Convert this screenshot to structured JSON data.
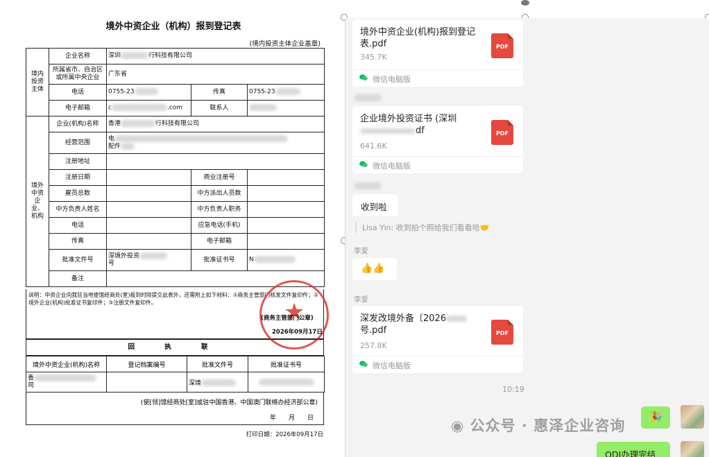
{
  "document": {
    "title": "境外中资企业（机构）报到登记表",
    "subtitle": "(境内投资主体企业盖章)",
    "section_domestic": "境内投资主体",
    "section_overseas": "境外中资企业、机构",
    "labels": {
      "company_name": "企业名称",
      "province": "所属省市、自治区或所属中央企业",
      "phone": "电话",
      "fax": "传真",
      "email": "电子邮箱",
      "contact": "联系人",
      "overseas_name": "企业(机构)名称",
      "scope": "经营范围",
      "reg_address": "注册地址",
      "reg_date": "注册日期",
      "biz_reg_no": "商业注册号",
      "employees": "雇员总数",
      "cn_staff": "中方派出人员数",
      "cn_head_name": "中方负责人姓名",
      "cn_head_title": "中方负责人职务",
      "phone2": "电话",
      "emergency_phone": "应急电话(手机)",
      "fax2": "传真",
      "email2": "电子邮箱",
      "approval_doc_no": "批准文件号",
      "approval_cert_no": "批准证书号",
      "remarks": "备注"
    },
    "values": {
      "company_name_pre": "深圳",
      "company_name_post": "行科技有限公司",
      "province": "广东省",
      "phone": "0755-23",
      "fax": "0755-23",
      "email_pre": "c",
      "email_post": ".com",
      "overseas_name_pre": "香港",
      "overseas_name_post": "行科技有限公司",
      "scope_line1": "电",
      "scope_line2": "配件",
      "approval_doc": "深境外投资",
      "approval_doc2": "号",
      "approval_cert": "N"
    },
    "note": "说明：中资企业向我驻当地使馆经商处(室)报到时除提交此表外，还需附上如下材料：①商务主管部门核发文件复印件；②境外企业(机构)批准证书复印件；③注册文件复印件。",
    "seal_text": "(商务主管部门公章)",
    "seal_date": "2026年09月17日",
    "receipt_title": "回 执 联",
    "receipt_headers": [
      "境外中资企业(机构)名称",
      "登记档案编号",
      "批准文件号",
      "批准证书号"
    ],
    "receipt_row_pre": "香",
    "receipt_row_pre2": "司",
    "receipt_doc": "深境",
    "receipt_sign": "(使[领]馆经商处[室]或驻中国香港、中国澳门联络办经济部公章)",
    "receipt_date": "年　　月　　日",
    "print_date": "打印日期：2026年09月17日"
  },
  "chat": {
    "messages": [
      {
        "type": "file",
        "name": "境外中资企业(机构)报到登记表.pdf",
        "size": "345.7K",
        "source": "微信电脑版",
        "icon": "pdf-icon"
      },
      {
        "type": "file",
        "name": "企业境外投资证书 (深圳",
        "name2": "df",
        "size": "641.6K",
        "source": "微信电脑版",
        "icon": "pdf-icon"
      },
      {
        "type": "text",
        "text": "收到啦"
      },
      {
        "type": "quote",
        "text": "Lisa Yin: 收到拍个照给我们看看哈🤝"
      },
      {
        "type": "emoji",
        "sender": "李爱",
        "text": "👍👍"
      },
      {
        "type": "file",
        "sender": "李爱",
        "name": "深发改境外备〔2026",
        "name2": "号.pdf",
        "size": "257.8K",
        "source": "微信电脑版",
        "icon": "pdf-icon"
      },
      {
        "type": "time",
        "text": "10:19"
      },
      {
        "type": "emoji-self",
        "text": "🎉"
      },
      {
        "type": "text-self",
        "text": "ODI办理完结"
      }
    ],
    "watermark": "公众号 · 惠泽企业咨询",
    "colors": {
      "pdf": "#e5483f",
      "self_bubble": "#95ec69",
      "wechat_green": "#07c160"
    }
  }
}
